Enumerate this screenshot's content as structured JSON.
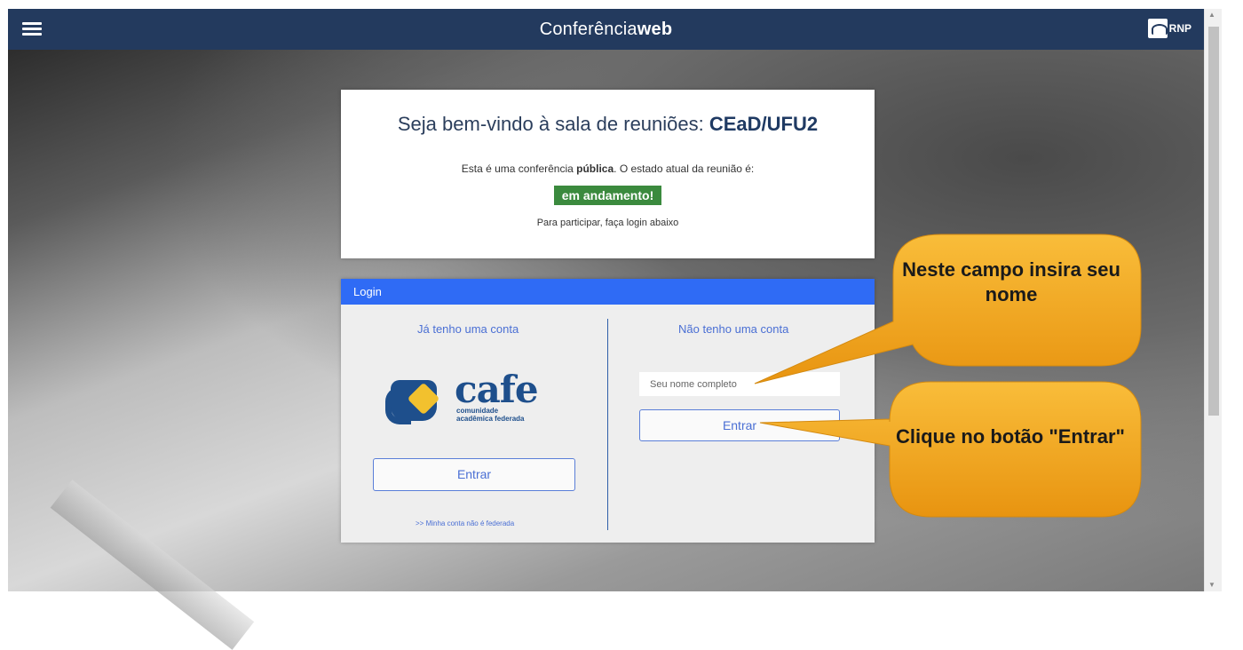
{
  "header": {
    "brand_light": "Conferência",
    "brand_bold": "web",
    "rnp_label": "RNP"
  },
  "welcome": {
    "title_prefix": "Seja bem-vindo à sala de reuniões: ",
    "room_name": "CEaD/UFU2",
    "status_line_prefix": "Esta é uma conferência ",
    "status_line_bold": "pública",
    "status_line_suffix": ". O estado atual da reunião é:",
    "state_badge": "em andamento!",
    "instruction": "Para participar, faça login abaixo"
  },
  "login": {
    "header": "Login",
    "left_title": "Já tenho uma conta",
    "cafe_word": "cafe",
    "cafe_sub1": "comunidade",
    "cafe_sub2": "acadêmica federada",
    "left_button": "Entrar",
    "federated_link": ">> Minha conta não é federada",
    "right_title": "Não tenho uma conta",
    "name_placeholder": "Seu nome completo",
    "right_button": "Entrar"
  },
  "callouts": {
    "name_hint": "Neste campo insira seu nome",
    "button_hint": "Clique no botão \"Entrar\""
  },
  "colors": {
    "topbar": "#233a5e",
    "login_header": "#2f6bf5",
    "status_green": "#3b8a3e",
    "callout_fill": "#f4a51c"
  }
}
